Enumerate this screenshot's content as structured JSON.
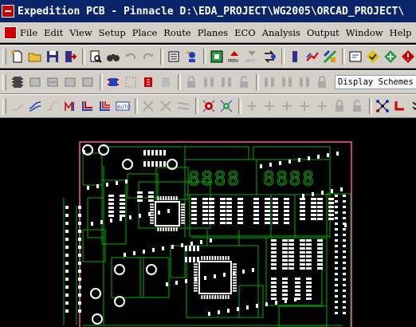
{
  "window": {
    "title": "Expedition PCB - Pinnacle  D:\\EDA_PROJECT\\WG2005\\ORCAD_PROJECT\\"
  },
  "menu": {
    "items": [
      "File",
      "Edit",
      "View",
      "Setup",
      "Place",
      "Route",
      "Planes",
      "ECO",
      "Analysis",
      "Output",
      "Window",
      "Help"
    ]
  },
  "toolbar2": {
    "display_schemes": "Display Schemes"
  },
  "board": {
    "outline_color": "#ff5aa0",
    "trace_color": "#00b000",
    "pad_color": "#ffffff",
    "seven_segment_digits": [
      "8888",
      "8888"
    ]
  }
}
